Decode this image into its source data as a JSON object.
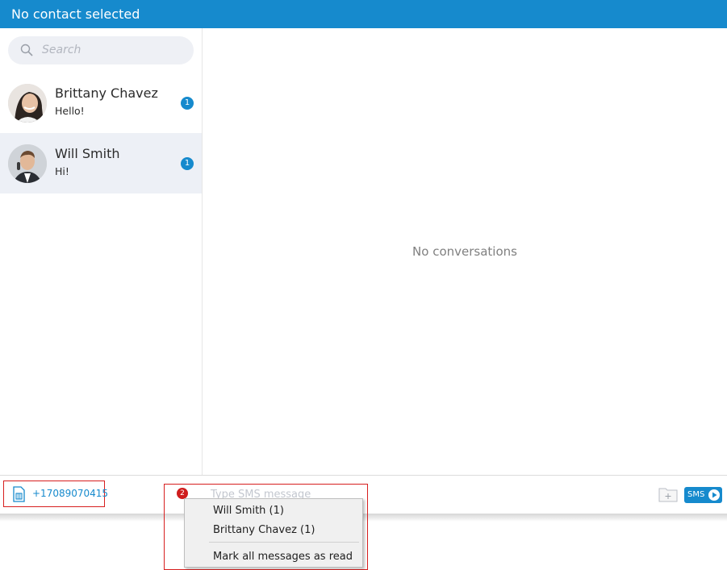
{
  "window": {
    "title": "No contact selected"
  },
  "search": {
    "placeholder": "Search"
  },
  "contacts": [
    {
      "name": "Brittany Chavez",
      "last_message": "Hello!",
      "unread": "1"
    },
    {
      "name": "Will Smith",
      "last_message": "Hi!",
      "unread": "1"
    }
  ],
  "main": {
    "empty_text": "No conversations"
  },
  "footer": {
    "phone_number": "+17089070415",
    "unread_total": "2",
    "message_placeholder": "Type SMS message",
    "send_label": "SMS"
  },
  "context_menu": {
    "items": [
      "Will Smith (1)",
      "Brittany Chavez (1)"
    ],
    "mark_all": "Mark all messages as read"
  },
  "colors": {
    "accent": "#168acd",
    "highlight_box": "#d71f1f",
    "selected_row": "#edf0f6"
  },
  "icons": [
    "search-icon",
    "sim-card-icon",
    "folder-add-icon",
    "send-icon"
  ]
}
